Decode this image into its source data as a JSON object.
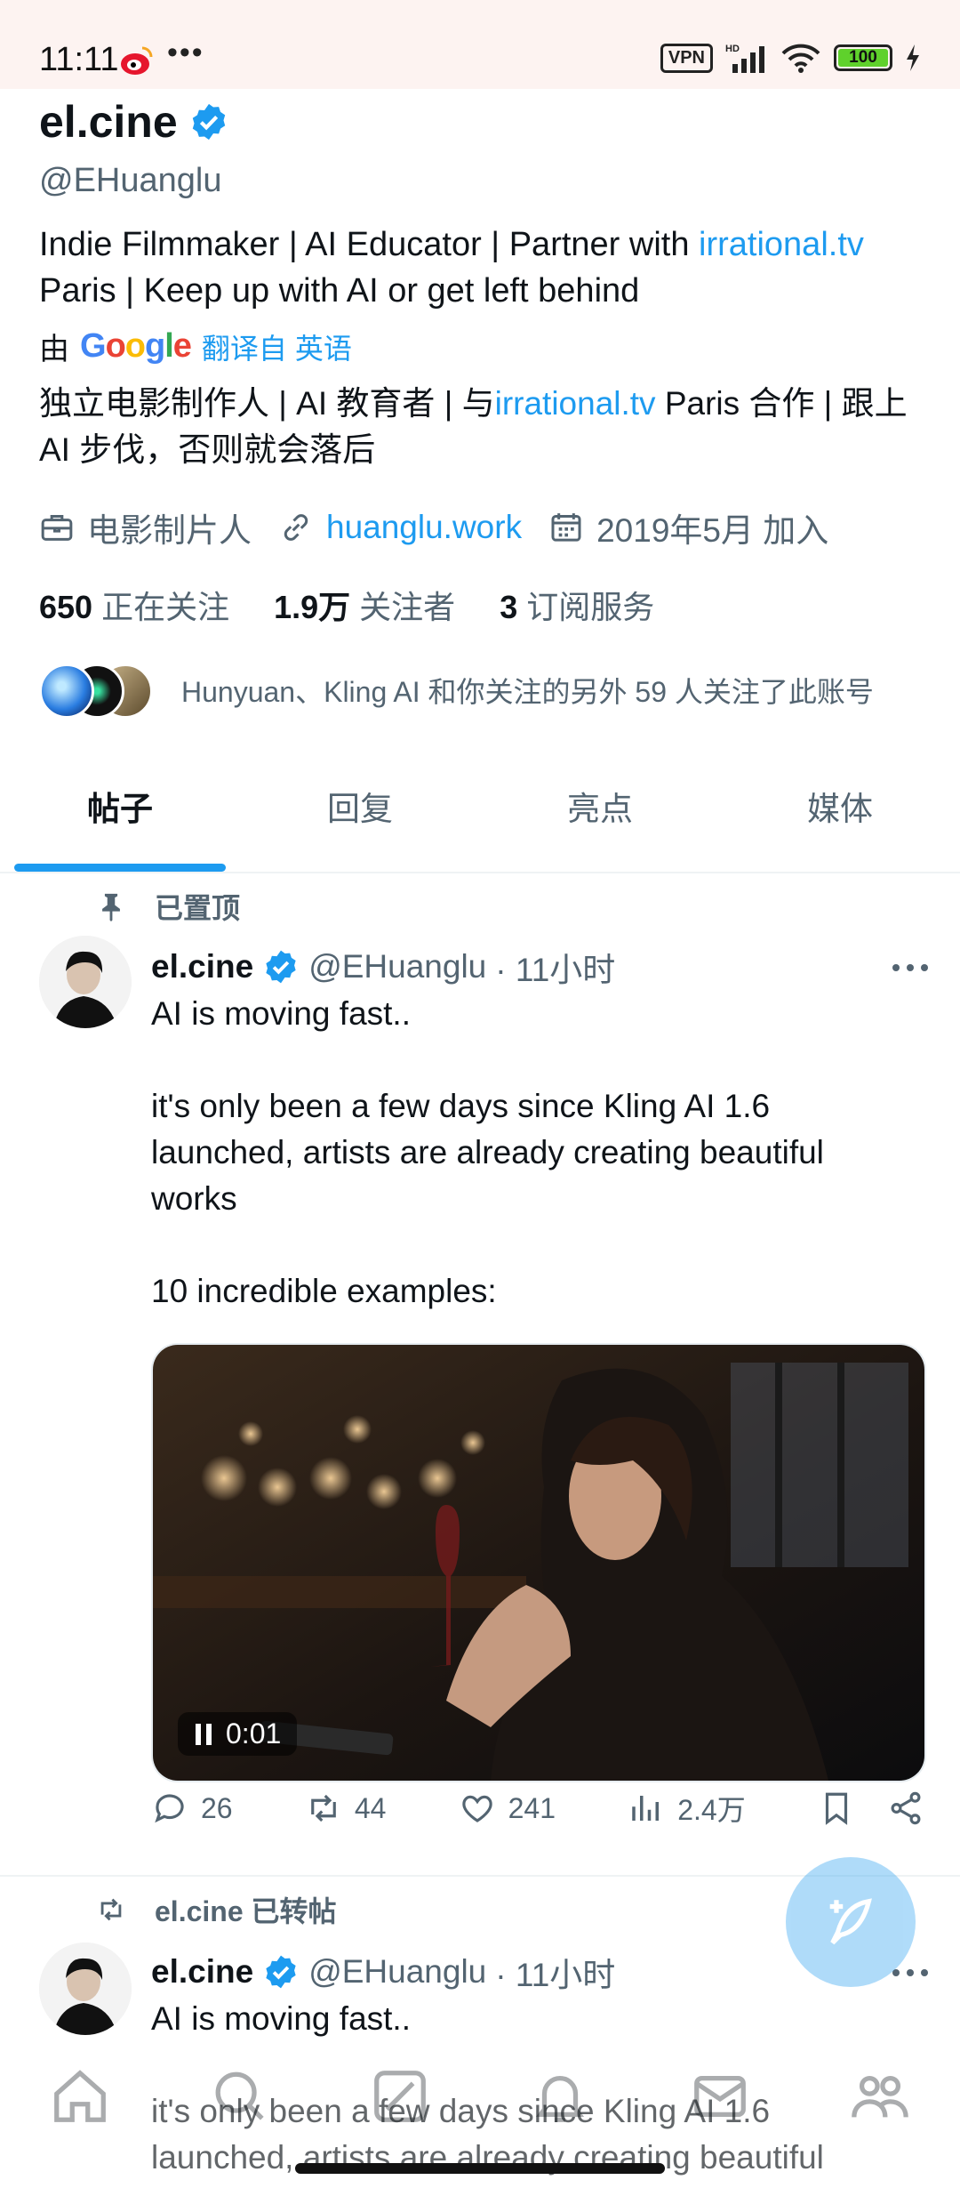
{
  "status_bar": {
    "time": "11:11",
    "dots": "•••",
    "vpn": "VPN",
    "battery": "100",
    "battery_level": 1.0
  },
  "profile": {
    "name": "el.cine",
    "handle": "@EHuanglu",
    "bio_line1_before": "Indie Filmmaker | AI Educator | Partner with ",
    "bio_link": "irrational.tv",
    "bio_line2": "Paris | Keep up with AI or get left behind",
    "translate_prefix": "由",
    "google_label": "Google",
    "translate_label": "翻译自 英语",
    "bio_cn_before": "独立电影制作人 | AI 教育者 | 与",
    "bio_cn_link": "irrational.tv",
    "bio_cn_after": " Paris 合作 | 跟上 AI 步伐，否则就会落后",
    "occupation": "电影制片人",
    "website": "huanglu.work",
    "joined": "2019年5月 加入",
    "following_count": "650",
    "following_label": "正在关注",
    "followers_count": "1.9万",
    "followers_label": "关注者",
    "subs_count": "3",
    "subs_label": "订阅服务",
    "followed_by": "Hunyuan、Kling AI 和你关注的另外 59 人关注了此账号"
  },
  "tabs": [
    {
      "label": "帖子",
      "active": true
    },
    {
      "label": "回复",
      "active": false
    },
    {
      "label": "亮点",
      "active": false
    },
    {
      "label": "媒体",
      "active": false
    }
  ],
  "tweet1": {
    "pinned_label": "已置顶",
    "name": "el.cine",
    "handle": "@EHuanglu",
    "time": "· 11小时",
    "text": "AI is moving fast..\n\nit's only been a few days since Kling AI 1.6 launched, artists are already creating beautiful works\n\n10 incredible examples:",
    "video_time": "0:01",
    "replies": "26",
    "retweets": "44",
    "likes": "241",
    "views": "2.4万"
  },
  "tweet2": {
    "retweet_label": "el.cine 已转帖",
    "name": "el.cine",
    "handle": "@EHuanglu",
    "time": "· 11小时",
    "text": "AI is moving fast..\n\nit's only been a few days since Kling AI 1.6\nlaunched, artists are already creating beautiful"
  },
  "colors": {
    "accent": "#1d9bf0",
    "text": "#0f1419",
    "secondary": "#536471"
  },
  "icons": [
    "weibo-icon",
    "verified-icon",
    "briefcase-icon",
    "link-icon",
    "calendar-icon",
    "pin-icon",
    "more-icon",
    "reply-icon",
    "retweet-icon",
    "like-icon",
    "views-icon",
    "bookmark-icon",
    "share-icon",
    "compose-icon",
    "home-icon",
    "search-icon",
    "grok-icon",
    "notifications-icon",
    "messages-icon",
    "communities-icon"
  ]
}
